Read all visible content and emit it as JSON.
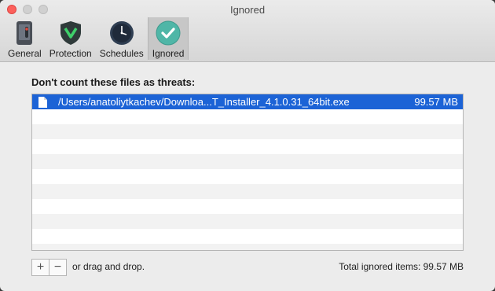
{
  "window": {
    "title": "Ignored"
  },
  "toolbar": {
    "tabs": [
      {
        "label": "General",
        "icon": "phone-switch-icon"
      },
      {
        "label": "Protection",
        "icon": "shield-icon"
      },
      {
        "label": "Schedules",
        "icon": "clock-icon"
      },
      {
        "label": "Ignored",
        "icon": "checkmark-icon",
        "active": true
      }
    ]
  },
  "main": {
    "heading": "Don't count these files as threats:",
    "files": [
      {
        "path": "/Users/anatoliytkachev/Downloa...T_Installer_4.1.0.31_64bit.exe",
        "size": "99.57 MB",
        "selected": true
      }
    ],
    "drag_text": "or drag and drop.",
    "total": "Total ignored items: 99.57 MB",
    "add_label": "+",
    "remove_label": "−"
  },
  "colors": {
    "selection": "#1c63d6",
    "accent_check": "#4fb6a7"
  }
}
